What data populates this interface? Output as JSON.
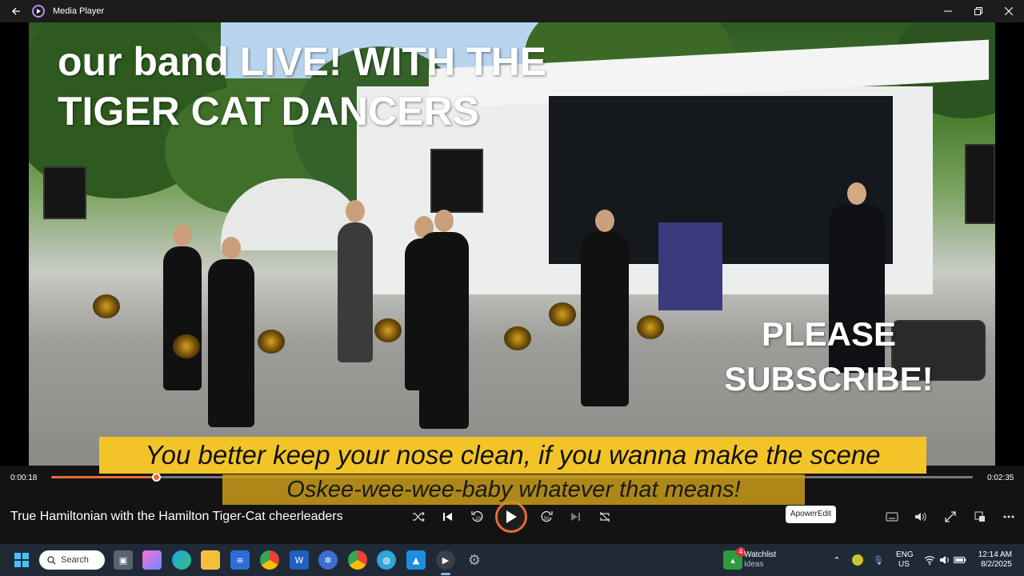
{
  "window": {
    "title": "Media Player"
  },
  "overlay": {
    "title_line1": "our band LIVE! WITH THE",
    "title_line2": "TIGER CAT DANCERS",
    "subscribe_line1": "PLEASE",
    "subscribe_line2": "SUBSCRIBE!"
  },
  "captions": {
    "line1": "You better keep your nose clean, if you wanna make the scene",
    "line2": "Oskee-wee-wee-baby whatever that means!"
  },
  "player": {
    "current_time": "0:00:18",
    "total_time": "0:02:35",
    "progress": 0.114,
    "video_title": "True Hamiltonian with the Hamilton Tiger-Cat cheerleaders",
    "tooltip": "ApowerEdit",
    "accent_color": "#e96a38"
  },
  "taskbar": {
    "search_label": "Search",
    "watchlist_title": "Watchlist",
    "watchlist_sub": "Ideas",
    "watchlist_badge": "4",
    "lang_line1": "ENG",
    "lang_line2": "US",
    "clock_time": "12:14 AM",
    "clock_date": "8/2/2025"
  },
  "icons": {
    "titlebar": [
      "back-arrow-icon",
      "media-player-icon",
      "minimize-icon",
      "restore-icon",
      "close-icon"
    ],
    "controls": [
      "shuffle-icon",
      "previous-icon",
      "rewind-10-icon",
      "play-icon",
      "forward-30-icon",
      "next-icon",
      "repeat-icon",
      "captions-icon",
      "volume-icon",
      "fullscreen-icon",
      "miniplayer-icon",
      "more-icon"
    ]
  }
}
